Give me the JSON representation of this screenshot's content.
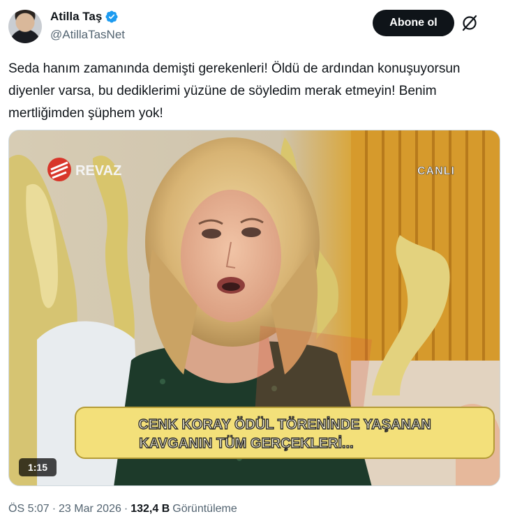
{
  "author": {
    "display_name": "Atilla Taş",
    "handle": "@AtillaTasNet"
  },
  "actions": {
    "follow_label": "Abone ol"
  },
  "tweet": {
    "text": "Seda hanım zamanında demişti gerekenleri! Öldü de ardından konuşuyorsun diyenler varsa, bu dediklerimi yüzüne de söyledim merak etmeyin! Benim mertliğimden şüphem yok!"
  },
  "video": {
    "channel_logo": "REVAZ",
    "live_badge": "CANLI",
    "caption_line1": "CENK KORAY ÖDÜL TÖRENİNDE YAŞANAN",
    "caption_line2": "KAVGANIN TÜM GERÇEKLERİ...",
    "duration": "1:15"
  },
  "meta": {
    "time": "ÖS 5:07",
    "separator": "·",
    "date": "23 Mar 2026",
    "views_count": "132,4 B",
    "views_label": "Görüntüleme"
  },
  "colors": {
    "text_primary": "#0f1419",
    "text_secondary": "#536471",
    "verified_blue": "#1d9bf0",
    "caption_yellow": "#f3e07a"
  }
}
